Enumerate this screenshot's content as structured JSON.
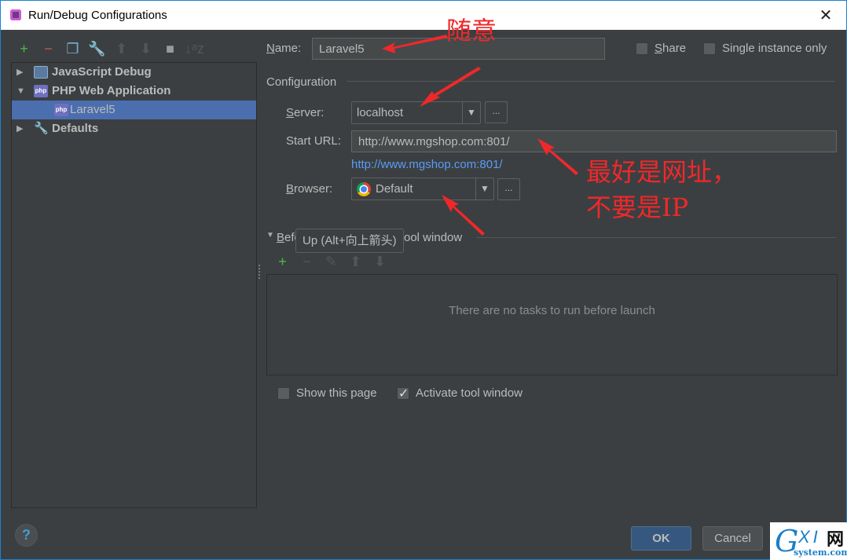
{
  "window": {
    "title": "Run/Debug Configurations",
    "close_icon": "close-icon"
  },
  "left_toolbar": [
    {
      "name": "add-icon",
      "glyph": "+",
      "color": "#4eb54e"
    },
    {
      "name": "remove-icon",
      "glyph": "−",
      "color": "#d9534f"
    },
    {
      "name": "copy-icon",
      "glyph": "❐",
      "color": "#7aaed6"
    },
    {
      "name": "edit-defaults-icon",
      "glyph": "🔧",
      "color": "#c8a060"
    },
    {
      "name": "move-up-icon",
      "glyph": "⬆",
      "color": "#555555"
    },
    {
      "name": "move-down-icon",
      "glyph": "⬇",
      "color": "#555555"
    },
    {
      "name": "folder-icon",
      "glyph": "■",
      "color": "#9a9a9a"
    },
    {
      "name": "sort-icon",
      "glyph": "↓ᵃz",
      "color": "#555555"
    }
  ],
  "tree": {
    "items": [
      {
        "label": "JavaScript Debug",
        "expanded": false,
        "icon": "javascript-debug-icon"
      },
      {
        "label": "PHP Web Application",
        "expanded": true,
        "icon": "php-icon"
      },
      {
        "label": "Laravel5",
        "selected": true,
        "icon": "php-icon"
      },
      {
        "label": "Defaults",
        "expanded": false,
        "icon": "wrench-icon"
      }
    ]
  },
  "form": {
    "name_label": "Name:",
    "name_value": "Laravel5",
    "share_label": "Share",
    "share_checked": false,
    "single_instance_label": "Single instance only",
    "single_instance_checked": false,
    "configuration_heading": "Configuration",
    "server_label": "Server:",
    "server_value": "localhost",
    "start_url_label": "Start URL:",
    "start_url_value": "http://www.mgshop.com:801/",
    "start_url_link": "http://www.mgshop.com:801/",
    "browser_label": "Browser:",
    "browser_value": "Default",
    "ellipsis": "...",
    "dropdown_glyph": "▼"
  },
  "before_launch": {
    "heading": "Before launch: Activate tool window",
    "heading_visible_prefix": "Befo",
    "heading_visible_suffix": "ool window",
    "toolbar": [
      {
        "name": "add-task-icon",
        "glyph": "+",
        "color": "#4eb54e"
      },
      {
        "name": "remove-task-icon",
        "glyph": "−",
        "color": "#555555"
      },
      {
        "name": "edit-task-icon",
        "glyph": "✎",
        "color": "#555555"
      },
      {
        "name": "task-up-icon",
        "glyph": "⬆",
        "color": "#555555"
      },
      {
        "name": "task-down-icon",
        "glyph": "⬇",
        "color": "#555555"
      }
    ],
    "empty_text": "There are no tasks to run before launch",
    "tooltip": "Up (Alt+向上箭头)"
  },
  "options": {
    "show_page_label": "Show this page",
    "show_page_checked": false,
    "activate_tool_window_label": "Activate tool window",
    "activate_tool_window_checked": true
  },
  "buttons": {
    "ok": "OK",
    "cancel": "Cancel",
    "help": "?"
  },
  "annotations": {
    "name_note": "随意",
    "url_note_line1": "最好是网址，",
    "url_note_line2": "不要是IP",
    "color": "#f0282a"
  },
  "watermark": {
    "g": "G",
    "xi": "XI",
    "net": "网",
    "domain": "system.com"
  }
}
